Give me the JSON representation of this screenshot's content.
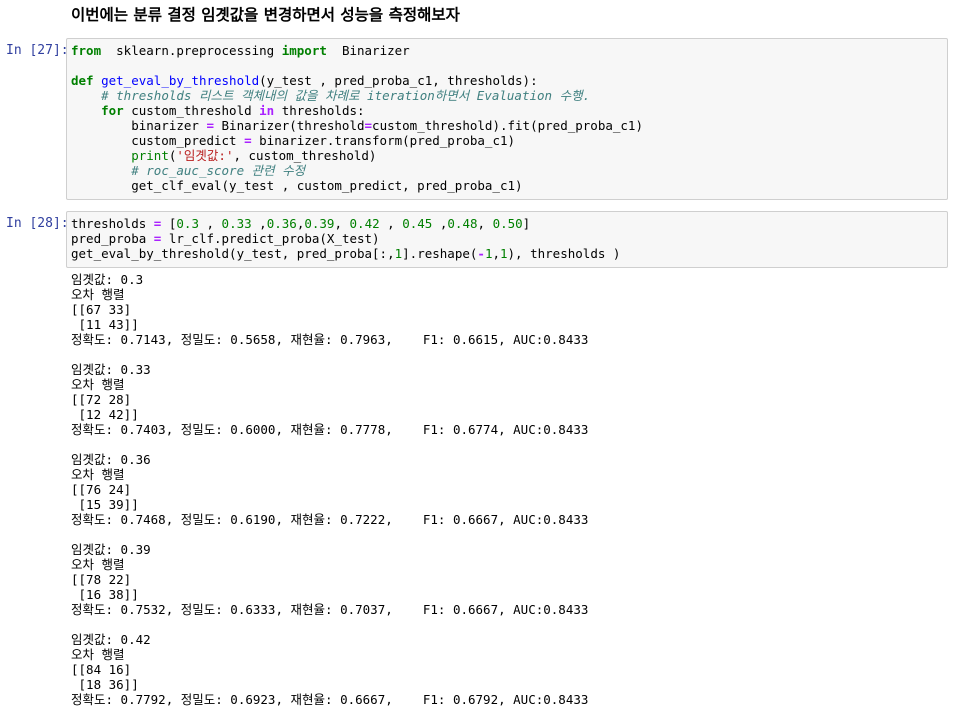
{
  "heading": "이번에는 분류 결정 임곗값을 변경하면서 성능을 측정해보자",
  "cells": [
    {
      "prompt": "In [27]:",
      "lines": [
        [
          [
            "kw",
            "from"
          ],
          [
            "",
            "  sklearn.preprocessing "
          ],
          [
            "kw",
            "import"
          ],
          [
            "",
            "  Binarizer"
          ]
        ],
        [
          [
            "",
            ""
          ]
        ],
        [
          [
            "kw",
            "def"
          ],
          [
            "",
            " "
          ],
          [
            "fn",
            "get_eval_by_threshold"
          ],
          [
            "",
            "(y_test , pred_proba_c1, thresholds):"
          ]
        ],
        [
          [
            "",
            "    "
          ],
          [
            "cm",
            "# thresholds 리스트 객체내의 값을 차례로 iteration하면서 Evaluation 수행."
          ]
        ],
        [
          [
            "",
            "    "
          ],
          [
            "kw",
            "for"
          ],
          [
            "",
            " custom_threshold "
          ],
          [
            "op",
            "in"
          ],
          [
            "",
            " thresholds:"
          ]
        ],
        [
          [
            "",
            "        binarizer "
          ],
          [
            "op",
            "="
          ],
          [
            "",
            " Binarizer(threshold"
          ],
          [
            "op",
            "="
          ],
          [
            "",
            "custom_threshold).fit(pred_proba_c1)"
          ]
        ],
        [
          [
            "",
            "        custom_predict "
          ],
          [
            "op",
            "="
          ],
          [
            "",
            " binarizer.transform(pred_proba_c1)"
          ]
        ],
        [
          [
            "",
            "        "
          ],
          [
            "bi",
            "print"
          ],
          [
            "",
            "("
          ],
          [
            "st",
            "'임곗값:'"
          ],
          [
            "",
            ", custom_threshold)"
          ]
        ],
        [
          [
            "",
            "        "
          ],
          [
            "cm",
            "# roc_auc_score 관련 수정"
          ]
        ],
        [
          [
            "",
            "        get_clf_eval(y_test , custom_predict, pred_proba_c1)"
          ]
        ]
      ]
    },
    {
      "prompt": "In [28]:",
      "lines": [
        [
          [
            "",
            "thresholds "
          ],
          [
            "op",
            "="
          ],
          [
            "",
            " ["
          ],
          [
            "nm",
            "0.3"
          ],
          [
            "",
            " , "
          ],
          [
            "nm",
            "0.33"
          ],
          [
            "",
            " ,"
          ],
          [
            "nm",
            "0.36"
          ],
          [
            "",
            ","
          ],
          [
            "nm",
            "0.39"
          ],
          [
            "",
            ", "
          ],
          [
            "nm",
            "0.42"
          ],
          [
            "",
            " , "
          ],
          [
            "nm",
            "0.45"
          ],
          [
            "",
            " ,"
          ],
          [
            "nm",
            "0.48"
          ],
          [
            "",
            ", "
          ],
          [
            "nm",
            "0.50"
          ],
          [
            "",
            "]"
          ]
        ],
        [
          [
            "",
            "pred_proba "
          ],
          [
            "op",
            "="
          ],
          [
            "",
            " lr_clf.predict_proba(X_test)"
          ]
        ],
        [
          [
            "",
            "get_eval_by_threshold(y_test, pred_proba[:,"
          ],
          [
            "nm",
            "1"
          ],
          [
            "",
            "].reshape("
          ],
          [
            "op",
            "-"
          ],
          [
            "nm",
            "1"
          ],
          [
            "",
            ","
          ],
          [
            "nm",
            "1"
          ],
          [
            "",
            "), thresholds )"
          ]
        ]
      ]
    }
  ],
  "output_blocks": [
    {
      "threshold_line": "임곗값: 0.3",
      "matrix_title": "오차 행렬",
      "row1": "[[67 33]",
      "row2": " [11 43]]",
      "metrics": "정확도: 0.7143, 정밀도: 0.5658, 재현율: 0.7963,    F1: 0.6615, AUC:0.8433"
    },
    {
      "threshold_line": "임곗값: 0.33",
      "matrix_title": "오차 행렬",
      "row1": "[[72 28]",
      "row2": " [12 42]]",
      "metrics": "정확도: 0.7403, 정밀도: 0.6000, 재현율: 0.7778,    F1: 0.6774, AUC:0.8433"
    },
    {
      "threshold_line": "임곗값: 0.36",
      "matrix_title": "오차 행렬",
      "row1": "[[76 24]",
      "row2": " [15 39]]",
      "metrics": "정확도: 0.7468, 정밀도: 0.6190, 재현율: 0.7222,    F1: 0.6667, AUC:0.8433"
    },
    {
      "threshold_line": "임곗값: 0.39",
      "matrix_title": "오차 행렬",
      "row1": "[[78 22]",
      "row2": " [16 38]]",
      "metrics": "정확도: 0.7532, 정밀도: 0.6333, 재현율: 0.7037,    F1: 0.6667, AUC:0.8433"
    },
    {
      "threshold_line": "임곗값: 0.42",
      "matrix_title": "오차 행렬",
      "row1": "[[84 16]",
      "row2": " [18 36]]",
      "metrics": "정확도: 0.7792, 정밀도: 0.6923, 재현율: 0.6667,    F1: 0.6792, AUC:0.8433"
    }
  ]
}
